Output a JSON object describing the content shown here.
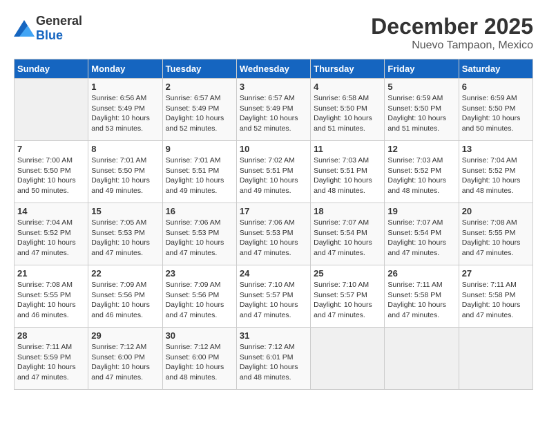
{
  "logo": {
    "general": "General",
    "blue": "Blue"
  },
  "title": "December 2025",
  "subtitle": "Nuevo Tampaon, Mexico",
  "days_of_week": [
    "Sunday",
    "Monday",
    "Tuesday",
    "Wednesday",
    "Thursday",
    "Friday",
    "Saturday"
  ],
  "weeks": [
    [
      {
        "day": "",
        "info": ""
      },
      {
        "day": "1",
        "info": "Sunrise: 6:56 AM\nSunset: 5:49 PM\nDaylight: 10 hours\nand 53 minutes."
      },
      {
        "day": "2",
        "info": "Sunrise: 6:57 AM\nSunset: 5:49 PM\nDaylight: 10 hours\nand 52 minutes."
      },
      {
        "day": "3",
        "info": "Sunrise: 6:57 AM\nSunset: 5:49 PM\nDaylight: 10 hours\nand 52 minutes."
      },
      {
        "day": "4",
        "info": "Sunrise: 6:58 AM\nSunset: 5:50 PM\nDaylight: 10 hours\nand 51 minutes."
      },
      {
        "day": "5",
        "info": "Sunrise: 6:59 AM\nSunset: 5:50 PM\nDaylight: 10 hours\nand 51 minutes."
      },
      {
        "day": "6",
        "info": "Sunrise: 6:59 AM\nSunset: 5:50 PM\nDaylight: 10 hours\nand 50 minutes."
      }
    ],
    [
      {
        "day": "7",
        "info": "Sunrise: 7:00 AM\nSunset: 5:50 PM\nDaylight: 10 hours\nand 50 minutes."
      },
      {
        "day": "8",
        "info": "Sunrise: 7:01 AM\nSunset: 5:50 PM\nDaylight: 10 hours\nand 49 minutes."
      },
      {
        "day": "9",
        "info": "Sunrise: 7:01 AM\nSunset: 5:51 PM\nDaylight: 10 hours\nand 49 minutes."
      },
      {
        "day": "10",
        "info": "Sunrise: 7:02 AM\nSunset: 5:51 PM\nDaylight: 10 hours\nand 49 minutes."
      },
      {
        "day": "11",
        "info": "Sunrise: 7:03 AM\nSunset: 5:51 PM\nDaylight: 10 hours\nand 48 minutes."
      },
      {
        "day": "12",
        "info": "Sunrise: 7:03 AM\nSunset: 5:52 PM\nDaylight: 10 hours\nand 48 minutes."
      },
      {
        "day": "13",
        "info": "Sunrise: 7:04 AM\nSunset: 5:52 PM\nDaylight: 10 hours\nand 48 minutes."
      }
    ],
    [
      {
        "day": "14",
        "info": "Sunrise: 7:04 AM\nSunset: 5:52 PM\nDaylight: 10 hours\nand 47 minutes."
      },
      {
        "day": "15",
        "info": "Sunrise: 7:05 AM\nSunset: 5:53 PM\nDaylight: 10 hours\nand 47 minutes."
      },
      {
        "day": "16",
        "info": "Sunrise: 7:06 AM\nSunset: 5:53 PM\nDaylight: 10 hours\nand 47 minutes."
      },
      {
        "day": "17",
        "info": "Sunrise: 7:06 AM\nSunset: 5:53 PM\nDaylight: 10 hours\nand 47 minutes."
      },
      {
        "day": "18",
        "info": "Sunrise: 7:07 AM\nSunset: 5:54 PM\nDaylight: 10 hours\nand 47 minutes."
      },
      {
        "day": "19",
        "info": "Sunrise: 7:07 AM\nSunset: 5:54 PM\nDaylight: 10 hours\nand 47 minutes."
      },
      {
        "day": "20",
        "info": "Sunrise: 7:08 AM\nSunset: 5:55 PM\nDaylight: 10 hours\nand 47 minutes."
      }
    ],
    [
      {
        "day": "21",
        "info": "Sunrise: 7:08 AM\nSunset: 5:55 PM\nDaylight: 10 hours\nand 46 minutes."
      },
      {
        "day": "22",
        "info": "Sunrise: 7:09 AM\nSunset: 5:56 PM\nDaylight: 10 hours\nand 46 minutes."
      },
      {
        "day": "23",
        "info": "Sunrise: 7:09 AM\nSunset: 5:56 PM\nDaylight: 10 hours\nand 47 minutes."
      },
      {
        "day": "24",
        "info": "Sunrise: 7:10 AM\nSunset: 5:57 PM\nDaylight: 10 hours\nand 47 minutes."
      },
      {
        "day": "25",
        "info": "Sunrise: 7:10 AM\nSunset: 5:57 PM\nDaylight: 10 hours\nand 47 minutes."
      },
      {
        "day": "26",
        "info": "Sunrise: 7:11 AM\nSunset: 5:58 PM\nDaylight: 10 hours\nand 47 minutes."
      },
      {
        "day": "27",
        "info": "Sunrise: 7:11 AM\nSunset: 5:58 PM\nDaylight: 10 hours\nand 47 minutes."
      }
    ],
    [
      {
        "day": "28",
        "info": "Sunrise: 7:11 AM\nSunset: 5:59 PM\nDaylight: 10 hours\nand 47 minutes."
      },
      {
        "day": "29",
        "info": "Sunrise: 7:12 AM\nSunset: 6:00 PM\nDaylight: 10 hours\nand 47 minutes."
      },
      {
        "day": "30",
        "info": "Sunrise: 7:12 AM\nSunset: 6:00 PM\nDaylight: 10 hours\nand 48 minutes."
      },
      {
        "day": "31",
        "info": "Sunrise: 7:12 AM\nSunset: 6:01 PM\nDaylight: 10 hours\nand 48 minutes."
      },
      {
        "day": "",
        "info": ""
      },
      {
        "day": "",
        "info": ""
      },
      {
        "day": "",
        "info": ""
      }
    ]
  ]
}
